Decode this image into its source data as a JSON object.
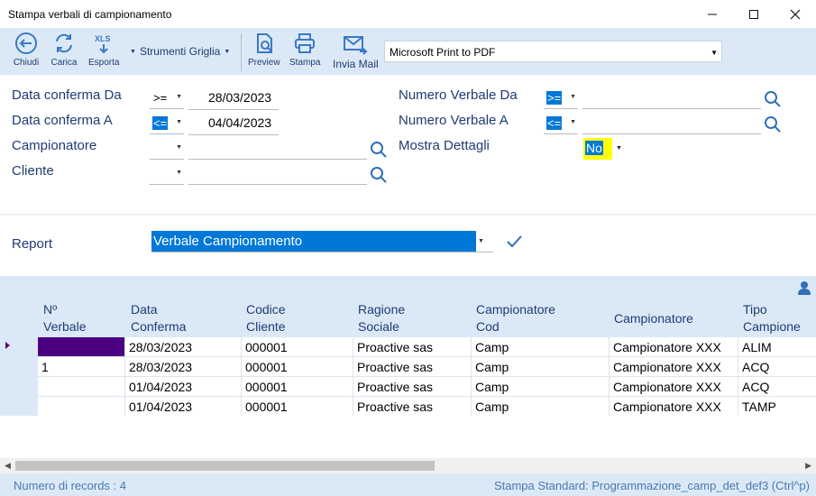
{
  "window": {
    "title": "Stampa verbali di campionamento"
  },
  "toolbar": {
    "chiudi": "Chiudi",
    "carica": "Carica",
    "esporta": "Esporta",
    "strumenti_griglia": "Strumenti Griglia",
    "preview": "Preview",
    "stampa": "Stampa",
    "invia_mail": "Invia Mail",
    "printer": "Microsoft Print to PDF",
    "xls_icon_text": "XLS"
  },
  "filters": {
    "data_conferma_da": {
      "label": "Data conferma Da",
      "op": ">=",
      "value": "28/03/2023"
    },
    "data_conferma_a": {
      "label": "Data conferma A",
      "op": "<=",
      "value": "04/04/2023"
    },
    "campionatore": {
      "label": "Campionatore",
      "op": "",
      "value": ""
    },
    "cliente": {
      "label": "Cliente",
      "op": "",
      "value": ""
    },
    "numero_verbale_da": {
      "label": "Numero Verbale Da",
      "op": ">=",
      "value": ""
    },
    "numero_verbale_a": {
      "label": "Numero Verbale A",
      "op": "<=",
      "value": ""
    },
    "mostra_dettagli": {
      "label": "Mostra Dettagli",
      "value": "No"
    }
  },
  "report": {
    "label": "Report",
    "value": "Verbale Campionamento"
  },
  "grid": {
    "headers": {
      "nverbale": [
        "Nº",
        "Verbale"
      ],
      "data_conferma": [
        "Data",
        "Conferma"
      ],
      "codice_cliente": [
        "Codice",
        "Cliente"
      ],
      "ragione_sociale": [
        "Ragione",
        "Sociale"
      ],
      "campionatore_cod": [
        "Campionatore",
        "Cod"
      ],
      "campionatore": [
        "Campionatore"
      ],
      "tipo_campione": [
        "Tipo",
        "Campione"
      ]
    },
    "rows": [
      {
        "nverbale": "",
        "data": "28/03/2023",
        "codice": "000001",
        "ragione": "Proactive sas",
        "camp_cod": "Camp",
        "campionatore": "Campionatore XXX",
        "tipo": "ALIM"
      },
      {
        "nverbale": "1",
        "data": "28/03/2023",
        "codice": "000001",
        "ragione": "Proactive sas",
        "camp_cod": "Camp",
        "campionatore": "Campionatore XXX",
        "tipo": "ACQ"
      },
      {
        "nverbale": "",
        "data": "01/04/2023",
        "codice": "000001",
        "ragione": "Proactive sas",
        "camp_cod": "Camp",
        "campionatore": "Campionatore XXX",
        "tipo": "ACQ"
      },
      {
        "nverbale": "",
        "data": "01/04/2023",
        "codice": "000001",
        "ragione": "Proactive sas",
        "camp_cod": "Camp",
        "campionatore": "Campionatore XXX",
        "tipo": "TAMP"
      }
    ]
  },
  "status": {
    "records": "Numero di records : 4",
    "stampa": "Stampa Standard: Programmazione_camp_det_def3 (Ctrl^p)"
  },
  "colors": {
    "accent": "#0078d7",
    "toolbar_bg": "#dbe9f6",
    "label_text": "#1f3b73",
    "highlight": "#ffff00",
    "selected_row": "#4b0082"
  }
}
